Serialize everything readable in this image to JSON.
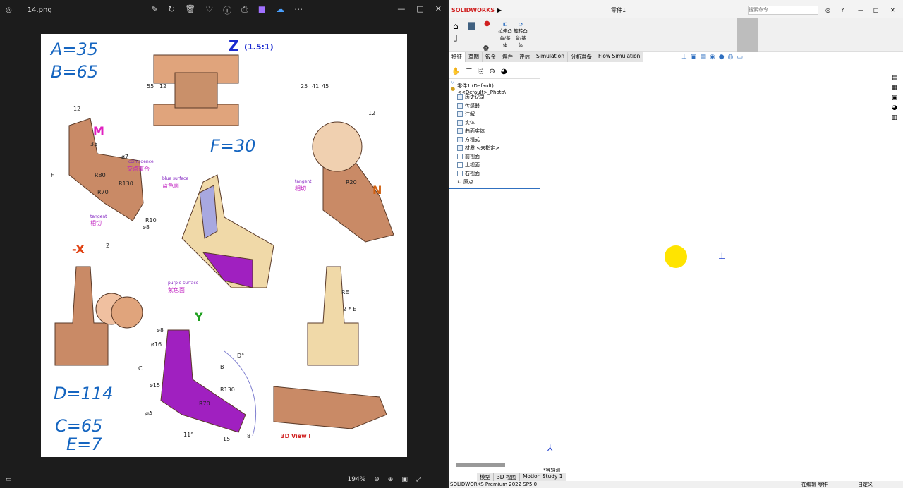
{
  "viewer": {
    "title": "14.png",
    "zoom": "194%",
    "toolbar_icons": [
      "edit-icon",
      "rotate-icon",
      "delete-icon",
      "heart-icon",
      "info-icon",
      "print-icon",
      "clipchamp-icon",
      "cloud-icon",
      "more-icon"
    ]
  },
  "drawing": {
    "handwritten": [
      "A=35",
      "B=65",
      "F=30",
      "D=114",
      "C=65",
      "E=7"
    ],
    "view_labels": {
      "z": "Z",
      "z_scale": "(1.5:1)",
      "m": "M",
      "n": "N",
      "x": "-X",
      "y": "Y",
      "view3d": "3D View I"
    },
    "dims": [
      "55",
      "12",
      "25",
      "41",
      "45",
      "12",
      "35",
      "R80",
      "R70",
      "R130",
      "R10",
      "ø8",
      "ø7",
      "F",
      "12",
      "R20",
      "2",
      "RE",
      "2 * E",
      "ø8",
      "ø16",
      "ø15",
      "øA",
      "B",
      "C",
      "D°",
      "R130",
      "R70",
      "11°",
      "15",
      "8"
    ],
    "notes": {
      "coincidence_en": "coincidence",
      "coincidence_cn": "交点重合",
      "blue_en": "blue surface",
      "blue_cn": "蓝色面",
      "tangent_en": "tangent",
      "tangent_cn": "相切",
      "tangent2_en": "tangent",
      "tangent2_cn": "相切",
      "purple_en": "purple surface",
      "purple_cn": "紫色面"
    }
  },
  "solidworks": {
    "logo": "SOLIDWORKS",
    "doc_title": "零件1",
    "search_placeholder": "搜索命令",
    "ribbon": {
      "extrude": "拉伸凸台/基体",
      "revolve": "旋转凸台/基体"
    },
    "tabs": [
      "特征",
      "草图",
      "钣金",
      "焊件",
      "评估",
      "Simulation",
      "分析准备",
      "Flow Simulation"
    ],
    "tree": {
      "root": "零件1 (Default) <<Default>_Photo\\",
      "items": [
        "历史记录",
        "传感器",
        "注解",
        "实体",
        "曲面实体",
        "方程式",
        "材质 <未指定>",
        "前视面",
        "上视面",
        "右视面",
        "原点"
      ]
    },
    "view_label": "*等轴测",
    "bottom_tabs": [
      "模型",
      "3D 视图",
      "Motion Study 1"
    ],
    "status": {
      "version": "SOLIDWORKS Premium 2022 SP5.0",
      "editing": "在编辑 零件",
      "custom": "自定义"
    }
  }
}
